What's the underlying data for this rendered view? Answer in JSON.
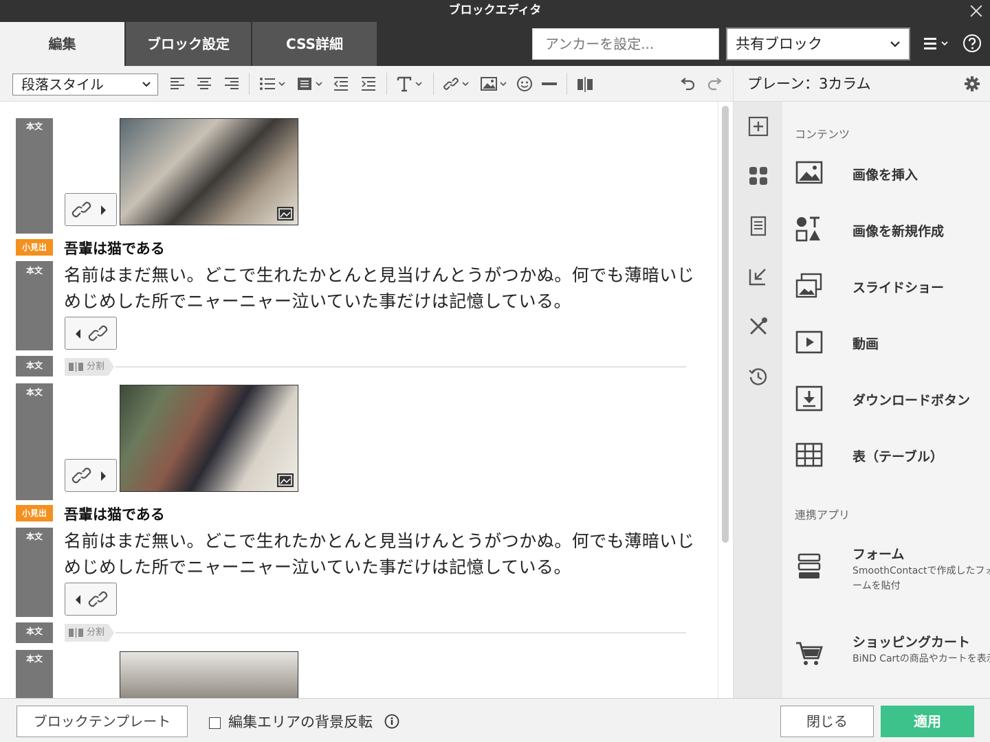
{
  "window": {
    "title": "ブロックエディタ"
  },
  "tabs": [
    {
      "label": "編集"
    },
    {
      "label": "ブロック設定"
    },
    {
      "label": "CSS詳細"
    }
  ],
  "header": {
    "anchor_placeholder": "アンカーを設定...",
    "shared_block_value": "共有ブロック"
  },
  "toolbar": {
    "paragraph_style": "段落スタイル"
  },
  "panel": {
    "title": "プレーン：3カラム"
  },
  "sidebar": {
    "contents_label": "コンテンツ",
    "items": [
      {
        "label": "画像を挿入"
      },
      {
        "label": "画像を新規作成"
      },
      {
        "label": "スライドショー"
      },
      {
        "label": "動画"
      },
      {
        "label": "ダウンロードボタン"
      },
      {
        "label": "表（テーブル）"
      }
    ],
    "apps_label": "連携アプリ",
    "apps": [
      {
        "label": "フォーム",
        "desc": "SmoothContactで作成したフォームを貼付"
      },
      {
        "label": "ショッピングカート",
        "desc": "BiND Cartの商品やカートを表示"
      }
    ]
  },
  "editor": {
    "tag_body": "本文",
    "tag_sub": "小見出",
    "split_label": "分割",
    "columns": [
      {
        "heading": "吾輩は猫である",
        "text": "名前はまだ無い。どこで生れたかとんと見当けんとうがつかぬ。何でも薄暗いじめじめした所でニャーニャー泣いていた事だけは記憶している。"
      },
      {
        "heading": "吾輩は猫である",
        "text": "名前はまだ無い。どこで生れたかとんと見当けんとうがつかぬ。何でも薄暗いじめじめした所でニャーニャー泣いていた事だけは記憶している。"
      }
    ]
  },
  "footer": {
    "template_button": "ブロックテンプレート",
    "invert_label": "編集エリアの背景反転",
    "close_button": "閉じる",
    "apply_button": "適用"
  },
  "colors": {
    "accent": "#3cc28a",
    "tag_orange": "#f4901e",
    "dark": "#333333"
  }
}
